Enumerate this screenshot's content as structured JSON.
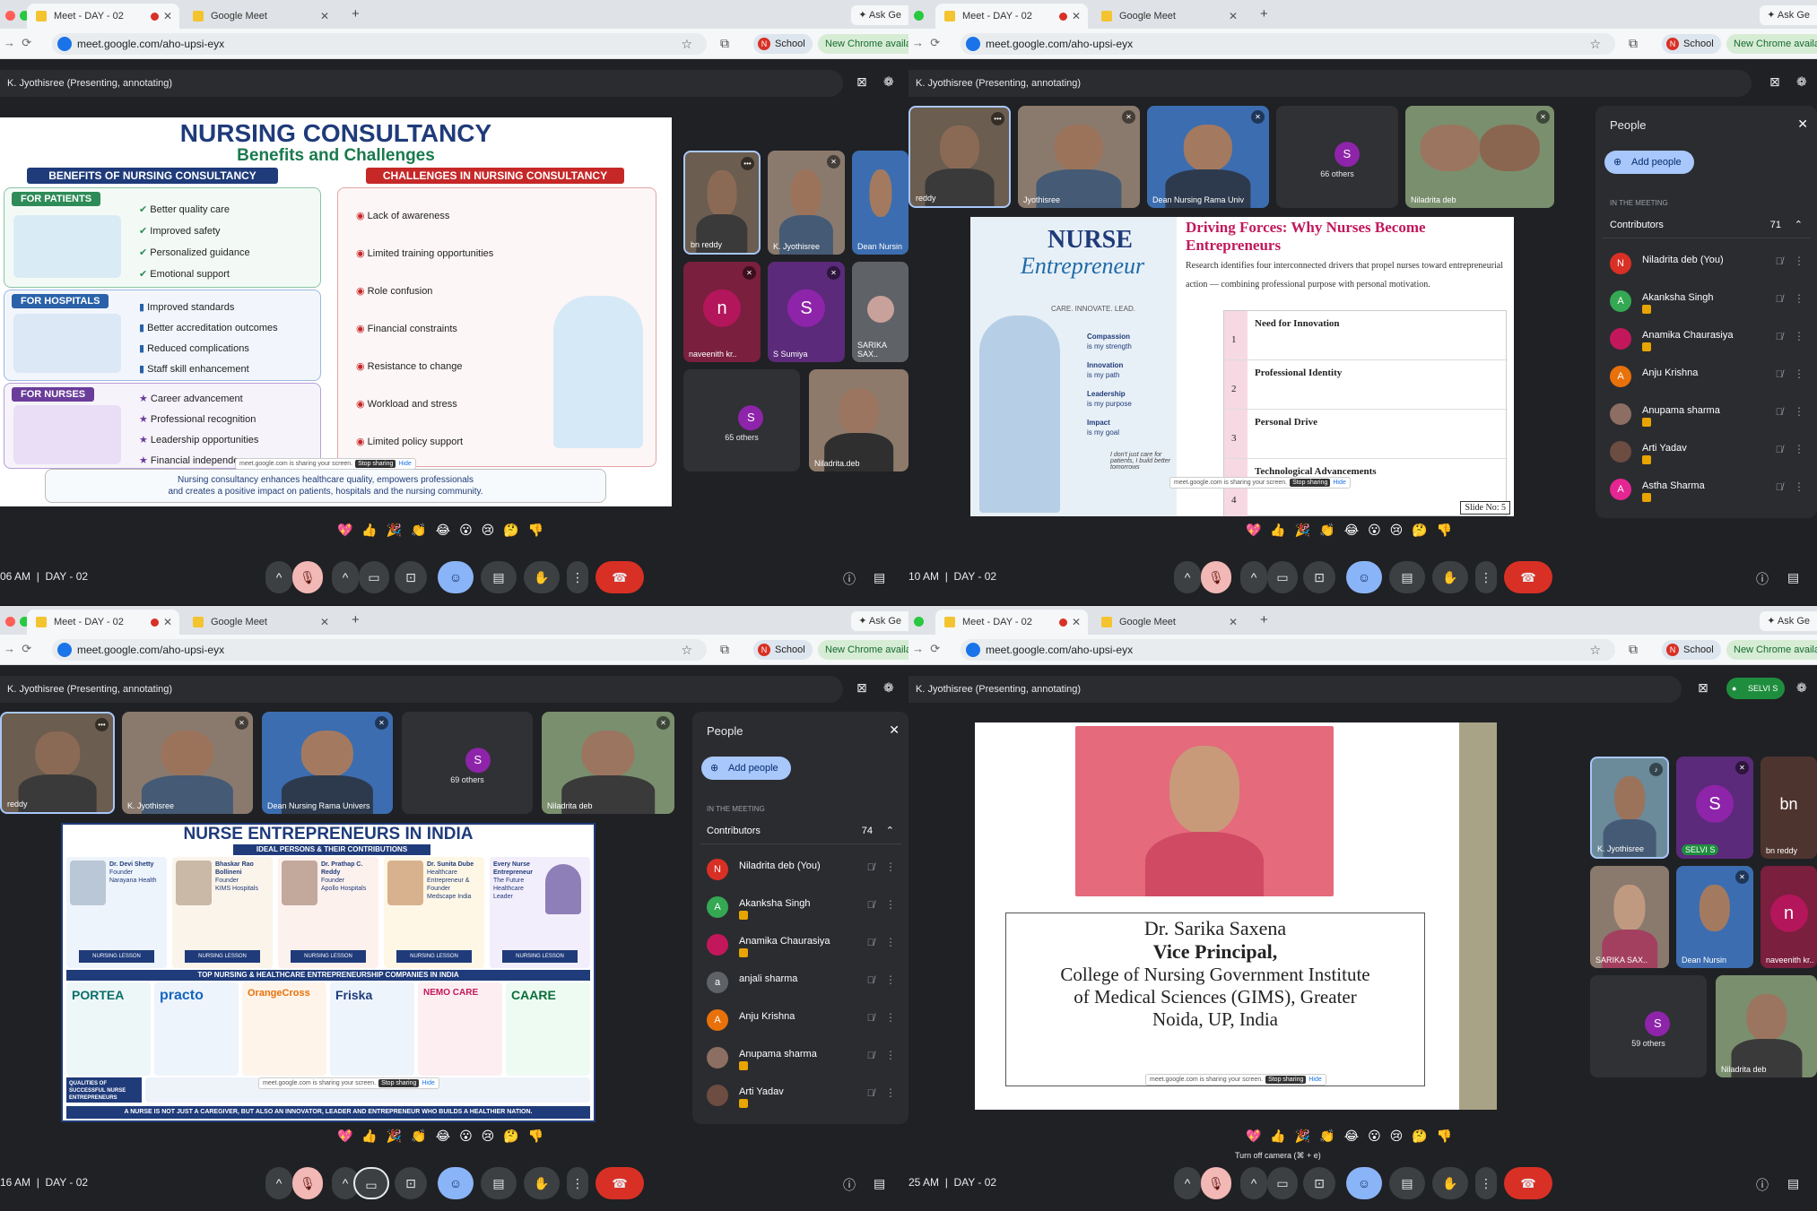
{
  "browser": {
    "tab_active": "Meet - DAY - 02",
    "tab_second": "Google Meet",
    "ask_label": "Ask Ge",
    "url": "meet.google.com/aho-upsi-eyx",
    "school_chip": "School",
    "school_initial": "N",
    "update_chip": "New Chrome availab"
  },
  "meet": {
    "presenting": "K. Jyothisree (Presenting, annotating)",
    "emojis": "💖👍🎉👏😂😮😢🤔👎",
    "q1_time": "06 AM",
    "q2_time": "10 AM",
    "q3_time": "16 AM",
    "q4_time": "25 AM",
    "meeting_name": "DAY - 02",
    "sharing_notice": "meet.google.com is sharing your screen.",
    "stop_sharing": "Stop sharing",
    "hide": "Hide",
    "camera_tooltip": "Turn off camera (⌘ + e)"
  },
  "q1": {
    "tiles": [
      {
        "name": "bn reddy"
      },
      {
        "name": "K. Jyothisree"
      },
      {
        "name": "Dean Nursin"
      },
      {
        "name": "naveenith kr..",
        "initial": "n",
        "color": "#b3165a"
      },
      {
        "name": "S Sumiya",
        "initial": "S",
        "color": "#8e24aa"
      },
      {
        "name": "SARIKA SAX.."
      },
      {
        "name": "65 others",
        "initial": "S"
      },
      {
        "name": "Niladrita.deb"
      }
    ],
    "slide": {
      "title": "NURSING CONSULTANCY",
      "subtitle": "Benefits and Challenges",
      "benefits_header": "BENEFITS OF NURSING CONSULTANCY",
      "challenges_header": "CHALLENGES IN NURSING CONSULTANCY",
      "groups": [
        {
          "label": "FOR PATIENTS",
          "items": [
            "Better quality care",
            "Improved safety",
            "Personalized guidance",
            "Emotional support"
          ]
        },
        {
          "label": "FOR HOSPITALS",
          "items": [
            "Improved standards",
            "Better accreditation outcomes",
            "Reduced complications",
            "Staff skill enhancement"
          ]
        },
        {
          "label": "FOR NURSES",
          "items": [
            "Career advancement",
            "Professional recognition",
            "Leadership opportunities",
            "Financial independence"
          ]
        }
      ],
      "challenges": [
        "Lack of awareness",
        "Limited training opportunities",
        "Role confusion",
        "Financial constraints",
        "Resistance to change",
        "Workload and stress",
        "Limited policy support"
      ],
      "footer_line1": "Nursing consultancy enhances healthcare quality, empowers professionals",
      "footer_line2": "and creates a positive impact on patients, hospitals and the nursing community."
    }
  },
  "q2": {
    "tiles": [
      {
        "name": "reddy"
      },
      {
        "name": "Jyothisree"
      },
      {
        "name": "Dean Nursing Rama Univ"
      },
      {
        "name": "66 others",
        "initial": "S"
      },
      {
        "name": "Niladrita deb"
      }
    ],
    "slide": {
      "left_title": "NURSE",
      "left_script": "Entrepreneur",
      "tagline": "CARE. INNOVATE. LEAD.",
      "traits": [
        {
          "t": "Compassion",
          "s": "is my strength"
        },
        {
          "t": "Innovation",
          "s": "is my path"
        },
        {
          "t": "Leadership",
          "s": "is my purpose"
        },
        {
          "t": "Impact",
          "s": "is my goal"
        }
      ],
      "quote": "I don't just care for patients, I build better tomorrows",
      "title": "Driving Forces: Why Nurses Become Entrepreneurs",
      "intro": "Research identifies four interconnected drivers that propel nurses toward entrepreneurial action — combining professional purpose with personal motivation.",
      "rows": [
        {
          "n": "1",
          "label": "Need for Innovation"
        },
        {
          "n": "2",
          "label": "Professional Identity"
        },
        {
          "n": "3",
          "label": "Personal Drive"
        },
        {
          "n": "4",
          "label": "Technological Advancements"
        }
      ],
      "slide_no": "Slide No: 5"
    },
    "people": {
      "title": "People",
      "add": "Add people",
      "in_meeting": "IN THE MEETING",
      "contributors": "Contributors",
      "count": "71",
      "list": [
        {
          "name": "Niladrita deb (You)",
          "initial": "N",
          "color": "#d93025"
        },
        {
          "name": "Akanksha Singh",
          "initial": "A",
          "color": "#34a853",
          "badge": true
        },
        {
          "name": "Anamika Chaurasiya",
          "initial": "",
          "color": "#c2185b",
          "badge": true
        },
        {
          "name": "Anju Krishna",
          "initial": "A",
          "color": "#e8710a"
        },
        {
          "name": "Anupama sharma",
          "initial": "",
          "color": "#8d6e63",
          "badge": true
        },
        {
          "name": "Arti Yadav",
          "initial": "",
          "color": "#6d4c41",
          "badge": true
        },
        {
          "name": "Astha Sharma",
          "initial": "A",
          "color": "#e52592",
          "badge": true
        }
      ]
    }
  },
  "q3": {
    "tiles": [
      {
        "name": "reddy"
      },
      {
        "name": "K. Jyothisree"
      },
      {
        "name": "Dean Nursing Rama Univers"
      },
      {
        "name": "69 others",
        "initial": "S"
      },
      {
        "name": "Niladrita deb"
      }
    ],
    "slide": {
      "title": "NURSE ENTREPRENEURS IN INDIA",
      "ribbon": "IDEAL PERSONS & THEIR CONTRIBUTIONS",
      "persons": [
        {
          "name": "Dr. Devi Shetty",
          "role": "Founder",
          "org": "Narayana Health",
          "lesson": "NURSING LESSON"
        },
        {
          "name": "Bhaskar Rao Bollineni",
          "role": "Founder",
          "org": "KIMS Hospitals",
          "lesson": "NURSING LESSON"
        },
        {
          "name": "Dr. Prathap C. Reddy",
          "role": "Founder",
          "org": "Apollo Hospitals",
          "lesson": "NURSING LESSON"
        },
        {
          "name": "Dr. Sunita Dube",
          "role": "Healthcare Entrepreneur & Founder",
          "org": "Medscape India",
          "lesson": "NURSING LESSON"
        },
        {
          "name": "Every Nurse Entrepreneur",
          "role": "The Future Healthcare Leader",
          "org": "",
          "lesson": "NURSING LESSON"
        }
      ],
      "companies_header": "TOP NURSING & HEALTHCARE ENTREPRENEURSHIP COMPANIES IN INDIA",
      "companies": [
        "PORTEA",
        "practo",
        "OrangeCross",
        "Friska",
        "NEMO CARE",
        "CAARE"
      ],
      "qualities": "QUALITIES OF SUCCESSFUL NURSE ENTREPRENEURS",
      "footer": "A NURSE IS NOT JUST A CAREGIVER, BUT ALSO AN INNOVATOR, LEADER AND ENTREPRENEUR WHO BUILDS A HEALTHIER NATION."
    },
    "people": {
      "title": "People",
      "add": "Add people",
      "in_meeting": "IN THE MEETING",
      "contributors": "Contributors",
      "count": "74",
      "list": [
        {
          "name": "Niladrita deb (You)",
          "initial": "N",
          "color": "#d93025"
        },
        {
          "name": "Akanksha Singh",
          "initial": "A",
          "color": "#34a853",
          "badge": true
        },
        {
          "name": "Anamika Chaurasiya",
          "initial": "",
          "color": "#c2185b",
          "badge": true
        },
        {
          "name": "anjali sharma",
          "initial": "a",
          "color": "#5f6368"
        },
        {
          "name": "Anju Krishna",
          "initial": "A",
          "color": "#e8710a"
        },
        {
          "name": "Anupama sharma",
          "initial": "",
          "color": "#8d6e63",
          "badge": true
        },
        {
          "name": "Arti Yadav",
          "initial": "",
          "color": "#6d4c41",
          "badge": true
        }
      ]
    }
  },
  "q4": {
    "selvi_chip": "SELVI S",
    "tiles": [
      {
        "name": "K. Jyothisree"
      },
      {
        "name": "SELVI S",
        "initial": "S",
        "color": "#8e24aa"
      },
      {
        "name": "bn reddy",
        "initial": "bn",
        "color": "#4e342e"
      },
      {
        "name": "SARIKA SAX.."
      },
      {
        "name": "Dean Nursin"
      },
      {
        "name": "naveenith kr..",
        "initial": "n",
        "color": "#b3165a"
      },
      {
        "name": "59 others",
        "initial": "S"
      },
      {
        "name": "Niladrita deb"
      }
    ],
    "slide": {
      "line1": "Dr. Sarika Saxena",
      "line2": "Vice Principal,",
      "line3": "College of Nursing Government Institute",
      "line4": "of Medical Sciences (GIMS), Greater",
      "line5": "Noida, UP, India"
    }
  }
}
